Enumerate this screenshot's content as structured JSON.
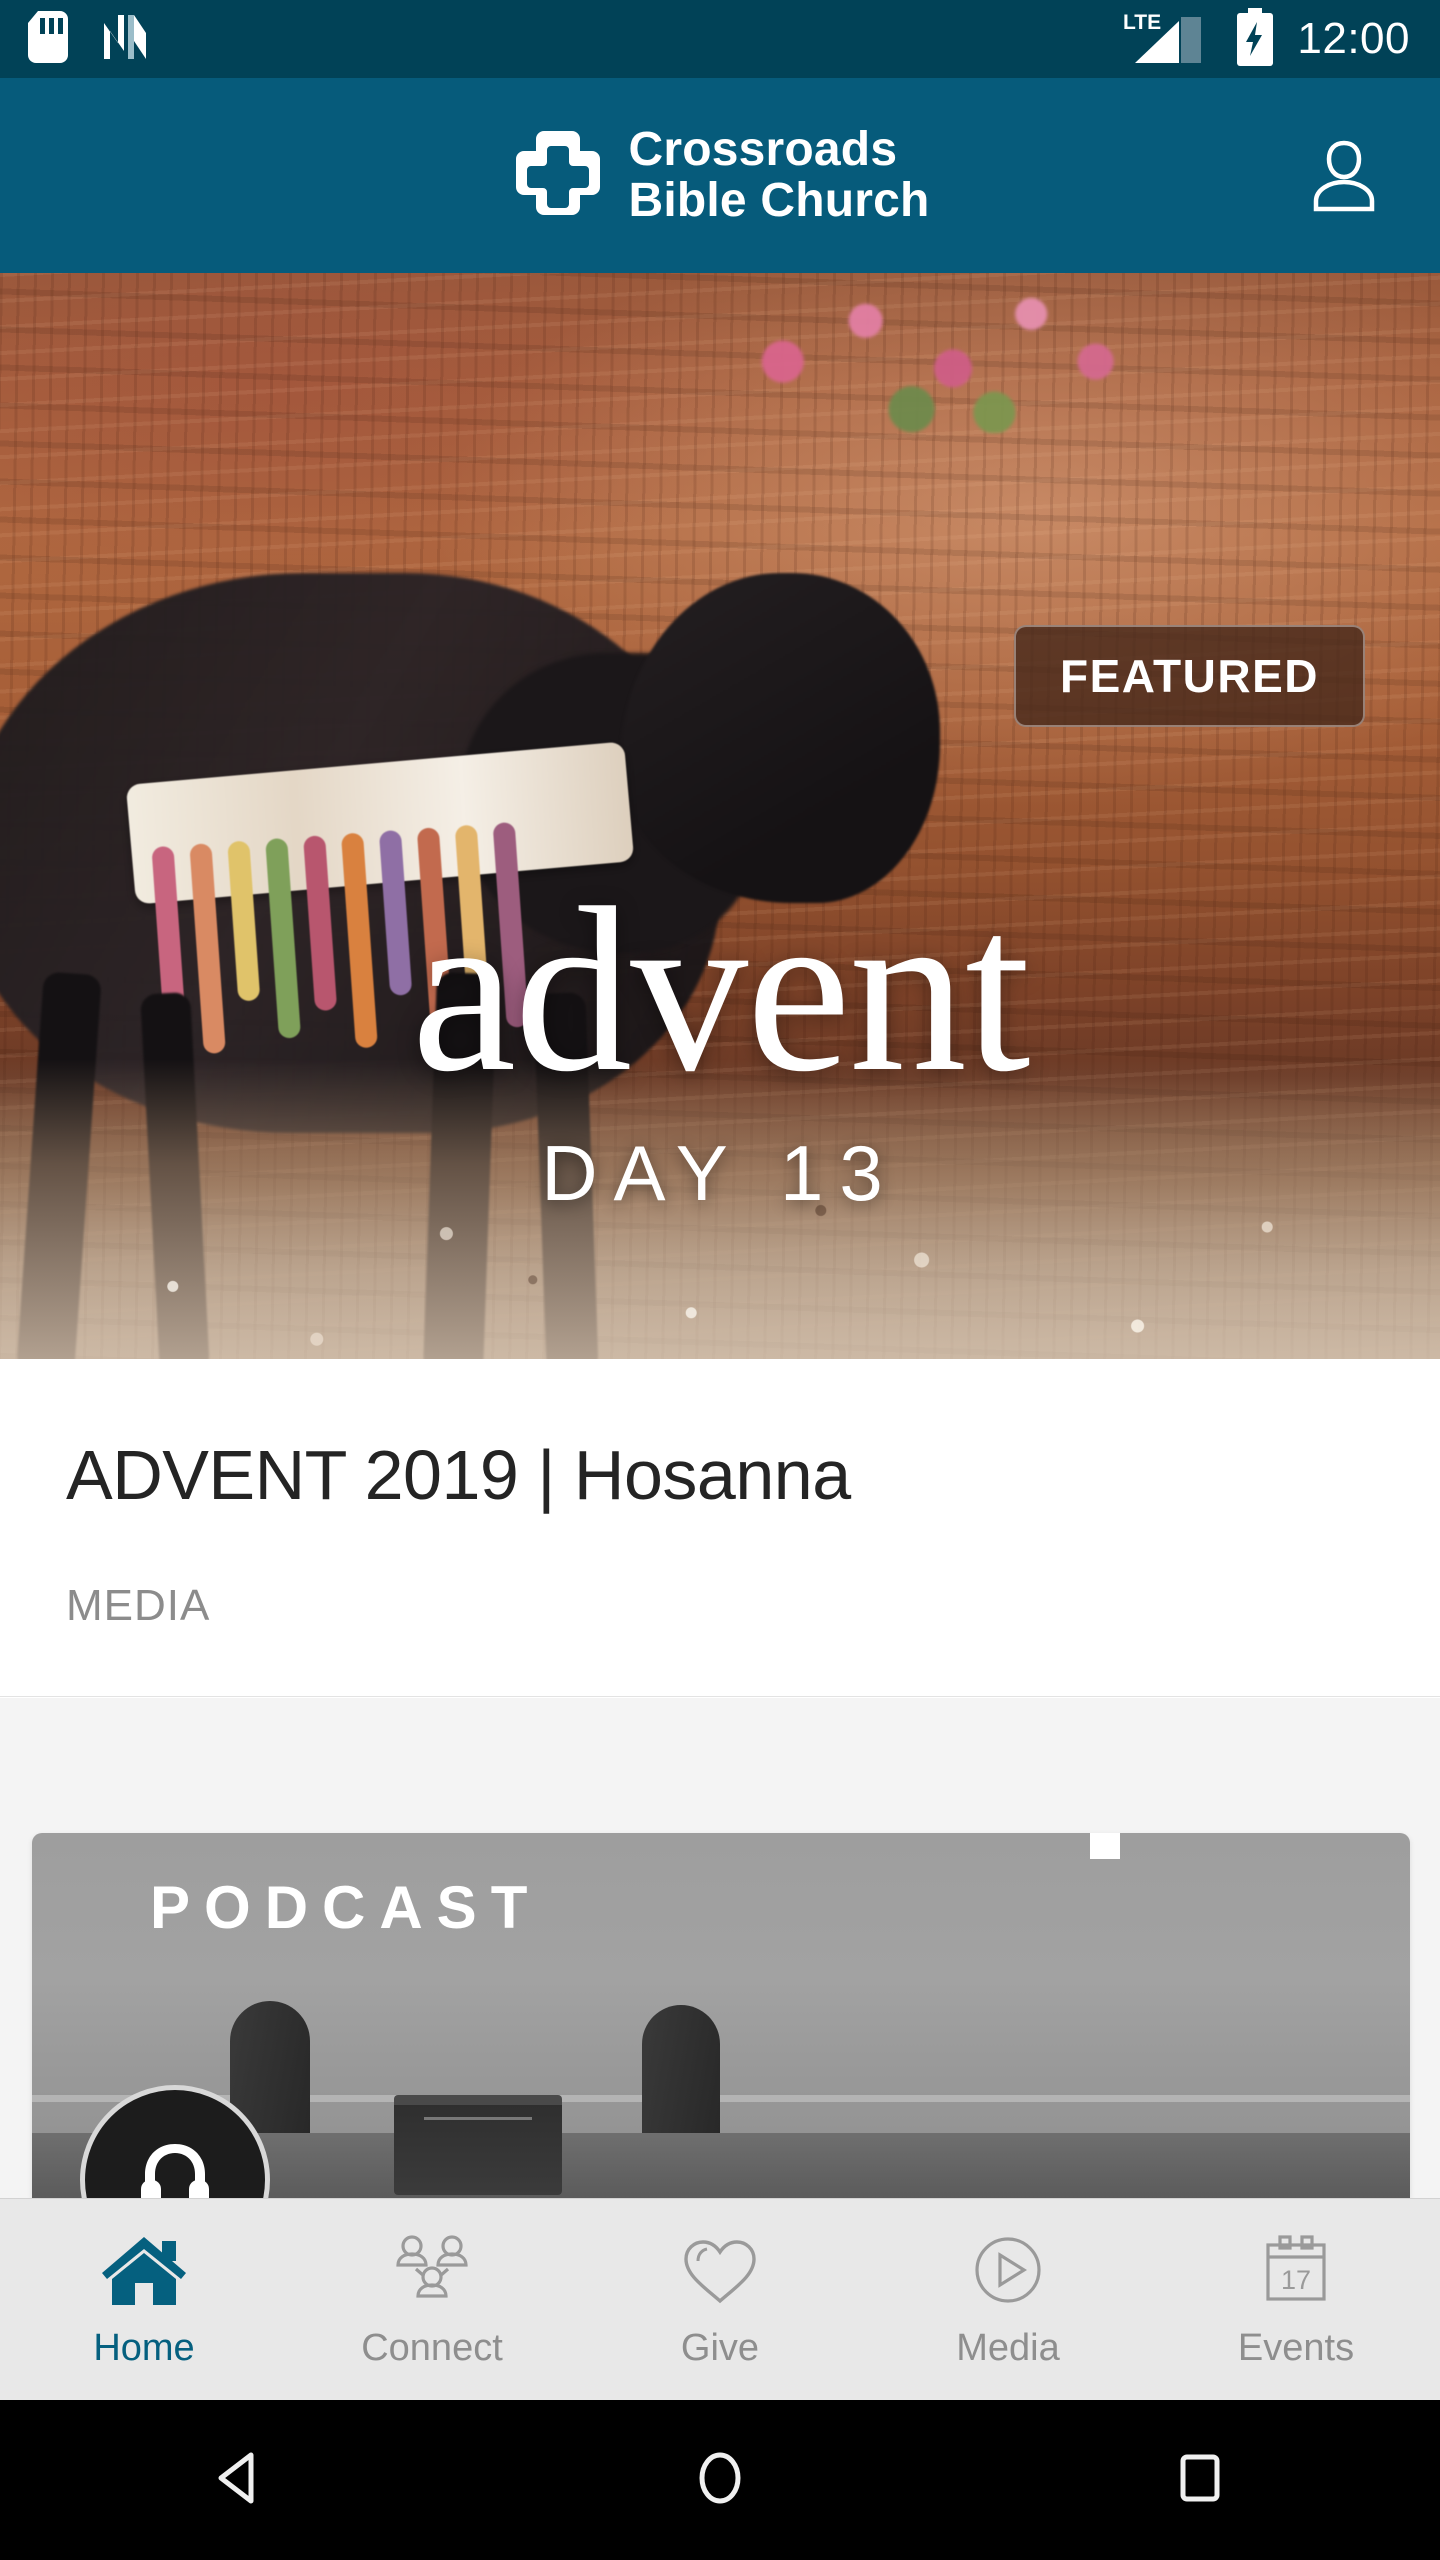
{
  "status_bar": {
    "time": "12:00",
    "network_label": "LTE",
    "icons": [
      "sd-card-icon",
      "nfc-icon",
      "lte-signal-icon",
      "battery-charging-icon"
    ]
  },
  "header": {
    "brand_line1": "Crossroads",
    "brand_line2": "Bible Church",
    "logo_icon": "cross-logo-icon",
    "profile_icon": "profile-person-icon",
    "background_color": "#065b7b"
  },
  "hero": {
    "badge_label": "FEATURED",
    "overlay_word": "advent",
    "overlay_day": "DAY 13",
    "badge_color": "#46281a"
  },
  "feature": {
    "title": "ADVENT 2019 | Hosanna",
    "category": "MEDIA"
  },
  "podcast": {
    "cover_word": "PODCAST",
    "play_icon": "headphones-icon"
  },
  "tabs": [
    {
      "label": "Home",
      "icon": "home-icon",
      "active": true
    },
    {
      "label": "Connect",
      "icon": "people-icon",
      "active": false
    },
    {
      "label": "Give",
      "icon": "heart-icon",
      "active": false
    },
    {
      "label": "Media",
      "icon": "play-circle-icon",
      "active": false
    },
    {
      "label": "Events",
      "icon": "calendar-icon",
      "active": false
    }
  ],
  "tab_active_color": "#05607f",
  "tab_inactive_color": "#8e8e8e",
  "calendar_day": "17",
  "android_nav": {
    "back": "back-triangle-icon",
    "home": "home-circle-icon",
    "recents": "recents-square-icon"
  }
}
